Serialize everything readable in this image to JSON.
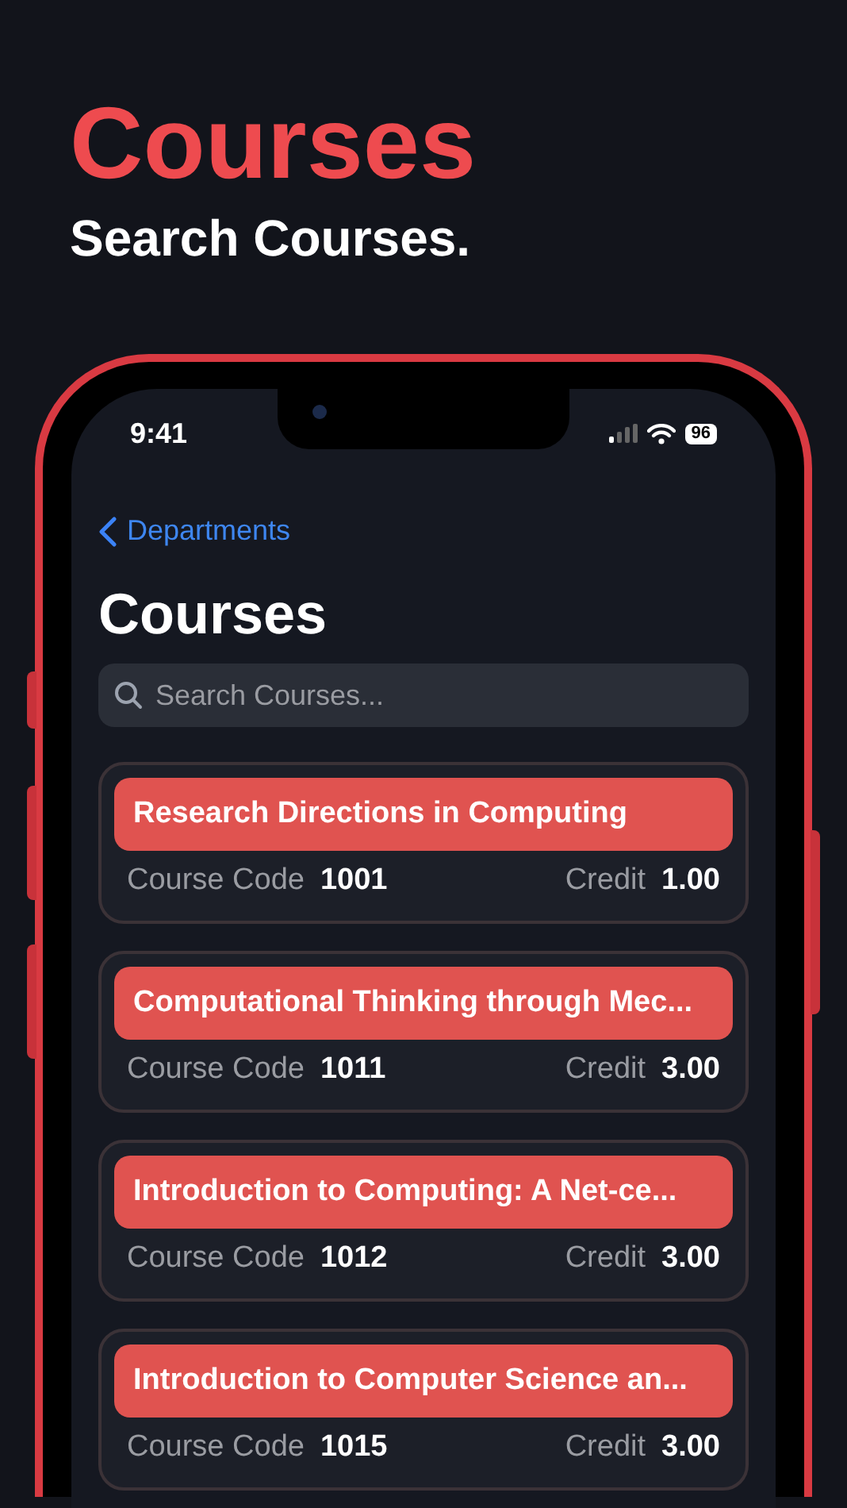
{
  "headline": "Courses",
  "subheadline": "Search Courses.",
  "status_bar": {
    "time": "9:41",
    "battery": "96"
  },
  "nav": {
    "back_label": "Departments",
    "title": "Courses"
  },
  "search": {
    "placeholder": "Search Courses..."
  },
  "courses": [
    {
      "title": "Research Directions in Computing",
      "code_label": "Course Code",
      "code": "1001",
      "credit_label": "Credit",
      "credit": "1.00"
    },
    {
      "title": "Computational Thinking through Mec...",
      "code_label": "Course Code",
      "code": "1011",
      "credit_label": "Credit",
      "credit": "3.00"
    },
    {
      "title": "Introduction to Computing: A Net-ce...",
      "code_label": "Course Code",
      "code": "1012",
      "credit_label": "Credit",
      "credit": "3.00"
    },
    {
      "title": "Introduction to Computer Science an...",
      "code_label": "Course Code",
      "code": "1015",
      "credit_label": "Credit",
      "credit": "3.00"
    }
  ]
}
